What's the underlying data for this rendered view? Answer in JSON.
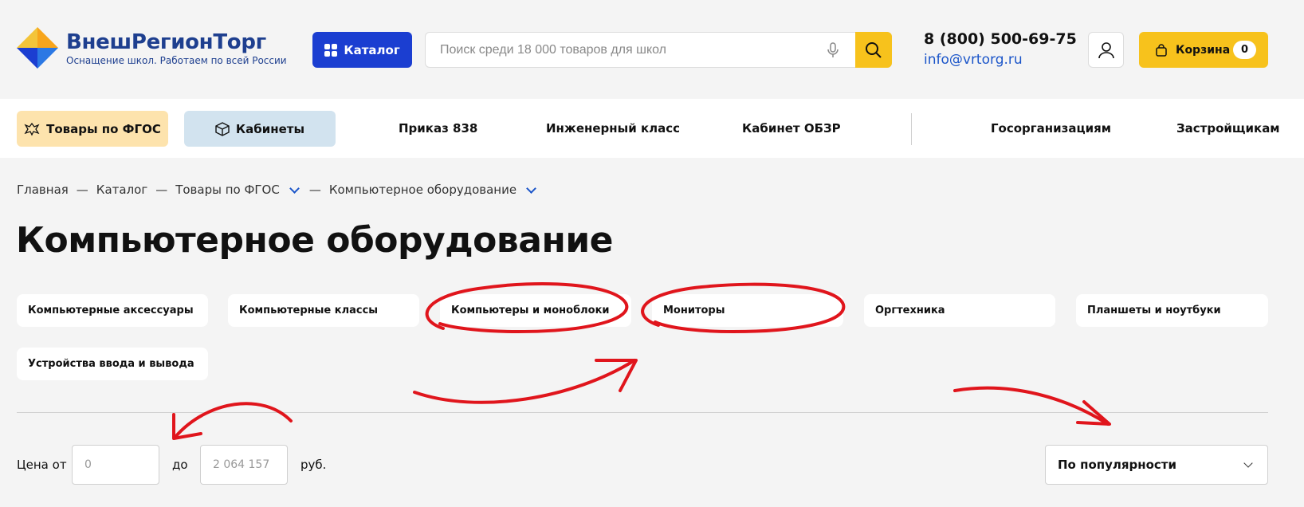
{
  "header": {
    "logo_name": "ВнешРегионТорг",
    "logo_tagline": "Оснащение школ. Работаем по всей России",
    "catalog_label": "Каталог",
    "search_placeholder": "Поиск среди 18 000 товаров для школ",
    "phone": "8 (800) 500-69-75",
    "email": "info@vrtorg.ru",
    "cart_label": "Корзина",
    "cart_count": "0"
  },
  "nav": {
    "fgos_label": "Товары по ФГОС",
    "cabinets_label": "Кабинеты",
    "links": [
      "Приказ 838",
      "Инженерный класс",
      "Кабинет ОБЗР",
      "Госорганизациям",
      "Застройщикам"
    ]
  },
  "breadcrumb": {
    "items": [
      "Главная",
      "Каталог",
      "Товары по ФГОС",
      "Компьютерное оборудование"
    ],
    "separator": "—"
  },
  "page_title": "Компьютерное оборудование",
  "categories": [
    "Компьютерные аксессуары",
    "Компьютерные классы",
    "Компьютеры и моноблоки",
    "Мониторы",
    "Оргтехника",
    "Планшеты и ноутбуки",
    "Устройства ввода и вывода"
  ],
  "filters": {
    "price_from_label": "Цена от",
    "price_from_placeholder": "0",
    "price_to_label": "до",
    "price_to_placeholder": "2 064 157",
    "currency": "руб.",
    "sort_value": "По популярности"
  },
  "colors": {
    "accent_blue": "#1b3ed1",
    "accent_yellow": "#f7c21c",
    "annotation_red": "#e0151c"
  },
  "icons": [
    "logo-icon",
    "grid-icon",
    "mic-icon",
    "search-icon",
    "user-icon",
    "cart-bag-icon",
    "emblem-icon",
    "cube-icon",
    "chevron-down-icon"
  ]
}
